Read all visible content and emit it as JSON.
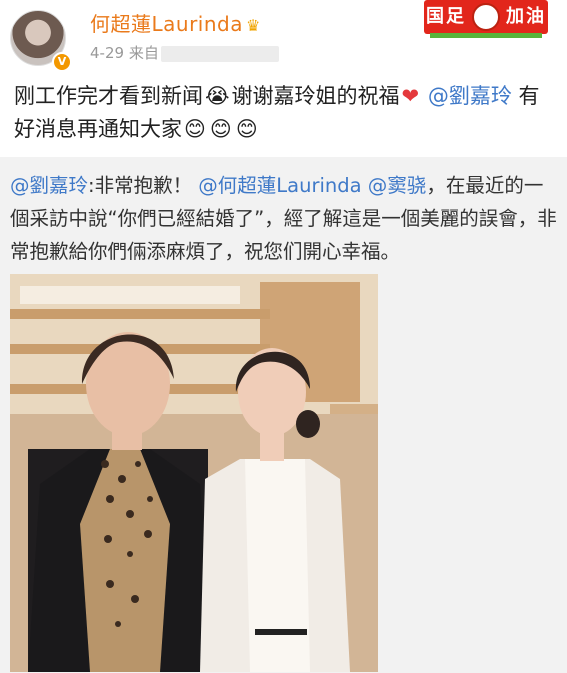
{
  "header": {
    "username": "何超蓮Laurinda",
    "verified_mark": "V",
    "crown_icon": "crown-icon",
    "time": "4-29",
    "source_prefix": "来自"
  },
  "post": {
    "text_part1": "刚工作完才看到新闻",
    "text_part2": "谢谢嘉玲姐的祝福",
    "mention1": "@劉嘉玲",
    "text_part3": "有好消息再通知大家",
    "emojis": [
      "sob-laugh-emoji",
      "heart-icon",
      "smile-emoji",
      "smile-emoji",
      "smile-emoji"
    ]
  },
  "repost": {
    "author_mention": "@劉嘉玲",
    "text_a": ":非常抱歉！",
    "mention_a": "@何超蓮Laurinda",
    "mention_b": "@窦骁",
    "text_b": "，在最近的一個采訪中說“你們已經結婚了”，經了解這是一個美麗的誤會，非常抱歉給你們倆添麻煩了，祝您们開心幸福。"
  },
  "logo": {
    "text_left": "国足",
    "text_right": "加油"
  }
}
